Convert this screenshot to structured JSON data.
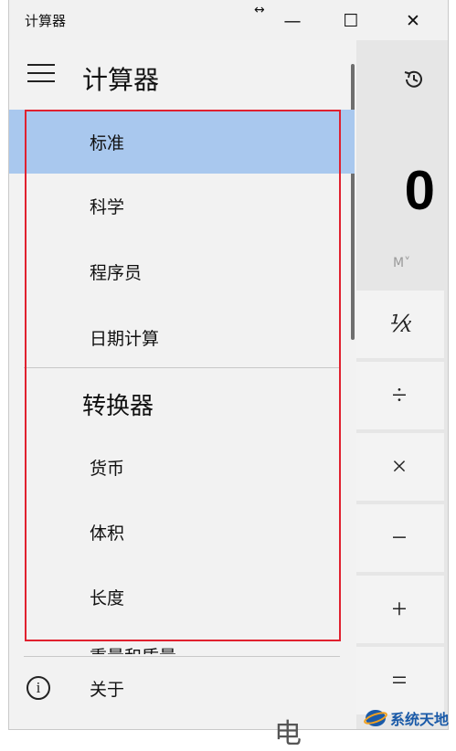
{
  "window": {
    "title": "计算器",
    "resize_glyph": "↔",
    "minimize_glyph": "—",
    "maximize_glyph": "☐",
    "close_glyph": "✕"
  },
  "calculator": {
    "display_value": "0",
    "memory_label": "M˅",
    "keys": [
      "⅟x",
      "÷",
      "×",
      "−",
      "+",
      "="
    ]
  },
  "nav": {
    "title": "计算器",
    "items": [
      {
        "label": "标准",
        "selected": true
      },
      {
        "label": "科学"
      },
      {
        "label": "程序员"
      },
      {
        "label": "日期计算"
      }
    ],
    "converter_header": "转换器",
    "converter_items": [
      {
        "label": "货币"
      },
      {
        "label": "体积"
      },
      {
        "label": "长度"
      }
    ],
    "cut_item_label": "重量和质量",
    "about_label": "关于",
    "about_icon_glyph": "i"
  },
  "watermark": {
    "text": "系统天地"
  },
  "bottom_partial_glyph": "电",
  "colors": {
    "selection": "#a9c8ee",
    "highlight_border": "#e0212f",
    "watermark_text": "#1a5aa8"
  }
}
